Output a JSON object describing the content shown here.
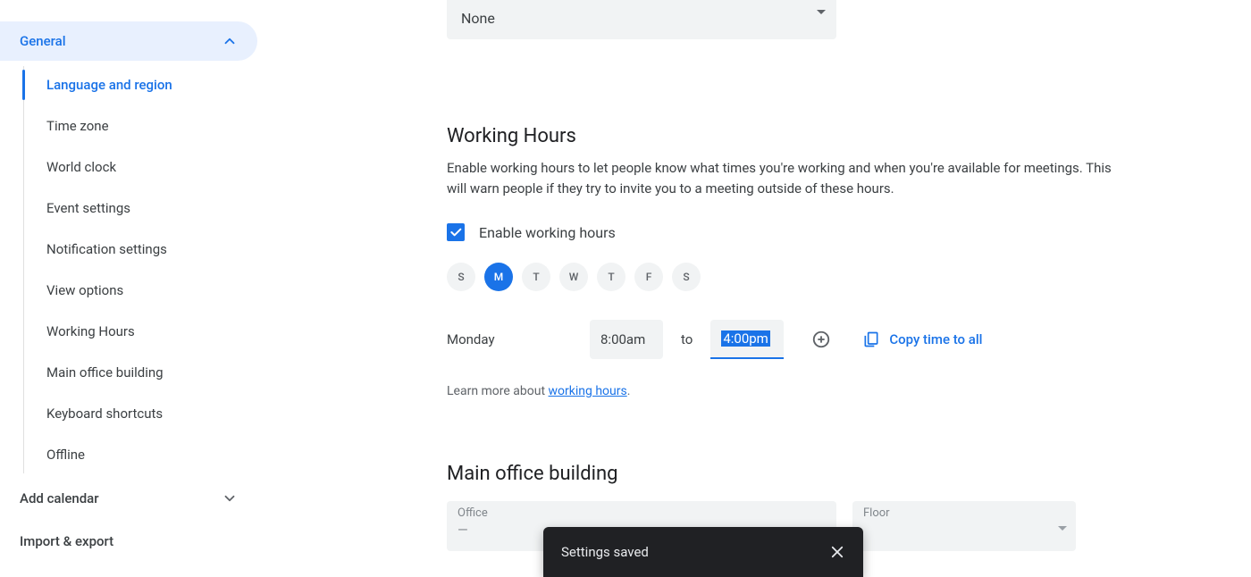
{
  "sidebar": {
    "group_general": "General",
    "items": [
      "Language and region",
      "Time zone",
      "World clock",
      "Event settings",
      "Notification settings",
      "View options",
      "Working Hours",
      "Main office building",
      "Keyboard shortcuts",
      "Offline"
    ],
    "group_add_calendar": "Add calendar",
    "group_import_export": "Import & export"
  },
  "top_dropdown": {
    "value": "None"
  },
  "working_hours": {
    "title": "Working Hours",
    "description": "Enable working hours to let people know what times you're working and when you're available for meetings. This will warn people if they try to invite you to a meeting outside of these hours.",
    "checkbox_label": "Enable working hours",
    "checkbox_checked": true,
    "days": [
      {
        "label": "S",
        "active": false
      },
      {
        "label": "M",
        "active": true
      },
      {
        "label": "T",
        "active": false
      },
      {
        "label": "W",
        "active": false
      },
      {
        "label": "T",
        "active": false
      },
      {
        "label": "F",
        "active": false
      },
      {
        "label": "S",
        "active": false
      }
    ],
    "row": {
      "day_name": "Monday",
      "start": "8:00am",
      "to": "to",
      "end": "4:00pm"
    },
    "copy_label": "Copy time to all",
    "learn_prefix": "Learn more about ",
    "learn_link": "working hours",
    "learn_suffix": "."
  },
  "main_office": {
    "title": "Main office building",
    "office_label": "Office",
    "office_value": "—",
    "floor_label": "Floor",
    "floor_value": ""
  },
  "snackbar": {
    "text": "Settings saved"
  }
}
